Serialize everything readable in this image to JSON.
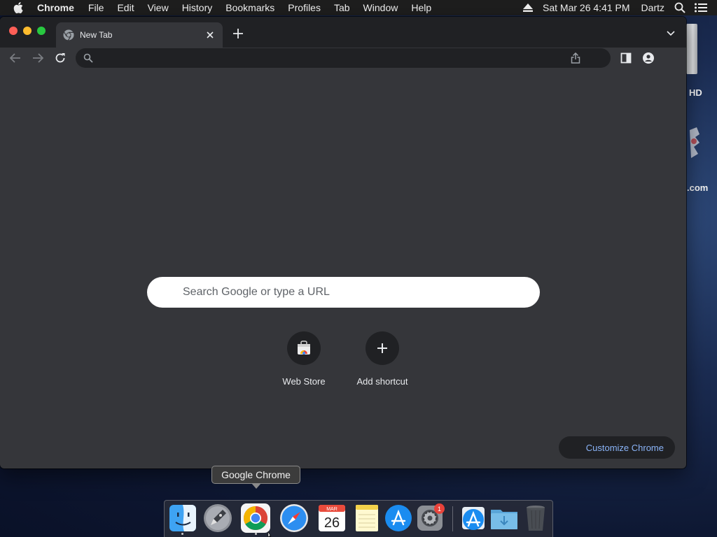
{
  "menubar": {
    "apple": "apple-icon",
    "app_name": "Chrome",
    "items": [
      "File",
      "Edit",
      "View",
      "History",
      "Bookmarks",
      "Profiles",
      "Tab",
      "Window",
      "Help"
    ],
    "status": {
      "datetime": "Sat Mar 26  4:41 PM",
      "user": "Dartz",
      "icons": [
        "eject-icon",
        "spotlight-search-icon",
        "notification-center-icon"
      ]
    }
  },
  "desktop": {
    "labels": [
      "HD",
      ".com"
    ]
  },
  "browser": {
    "tab": {
      "title": "New Tab",
      "favicon": "chrome-icon"
    },
    "toolbar": {
      "omnibox_value": "",
      "omnibox_placeholder": ""
    },
    "ntp": {
      "search_placeholder": "Search Google or type a URL",
      "shortcuts": [
        {
          "label": "Web Store",
          "icon": "web-store-icon"
        },
        {
          "label": "Add shortcut",
          "icon": "plus-icon"
        }
      ],
      "customize_label": "Customize Chrome"
    }
  },
  "dock": {
    "tooltip": "Google Chrome",
    "apps": [
      {
        "icon": "finder-icon",
        "running": true
      },
      {
        "icon": "launchpad-icon",
        "running": false
      },
      {
        "icon": "chrome-icon",
        "running": true
      },
      {
        "icon": "safari-icon",
        "running": false
      },
      {
        "icon": "calendar-icon",
        "month": "MAR",
        "day": "26",
        "running": false
      },
      {
        "icon": "notes-icon",
        "running": false
      },
      {
        "icon": "app-store-icon",
        "running": false
      },
      {
        "icon": "system-preferences-icon",
        "badge": "1",
        "running": false
      },
      {
        "icon": "app-store-folder-icon",
        "running": false
      },
      {
        "icon": "downloads-folder-icon",
        "running": false
      },
      {
        "icon": "trash-icon",
        "running": false
      }
    ]
  },
  "colors": {
    "window_bg": "#35363a",
    "tabstrip_bg": "#202124",
    "accent_link": "#8ab4f8"
  }
}
